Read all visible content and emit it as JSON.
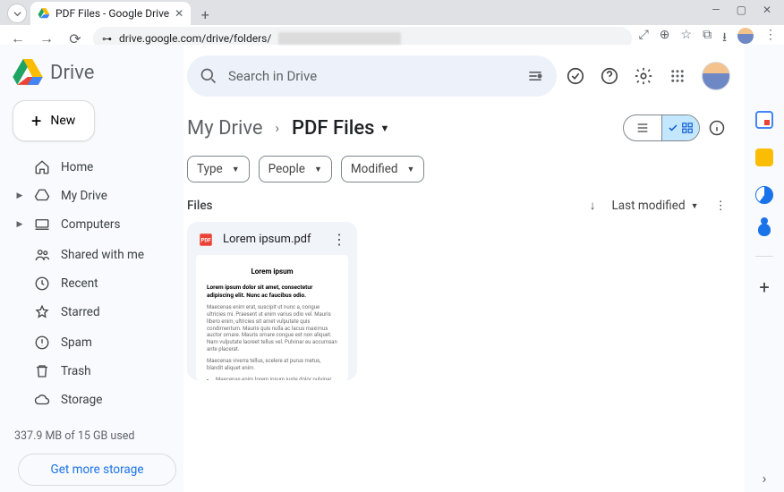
{
  "browser": {
    "tab_title": "PDF Files - Google Drive",
    "url_visible": "drive.google.com/drive/folders/",
    "url_obscured": "xxxxxxxxxxxxxxxxxxxxxxx"
  },
  "brand": "Drive",
  "new_button": "New",
  "nav": {
    "home": "Home",
    "my_drive": "My Drive",
    "computers": "Computers",
    "shared": "Shared with me",
    "recent": "Recent",
    "starred": "Starred",
    "spam": "Spam",
    "trash": "Trash",
    "storage": "Storage"
  },
  "storage": {
    "text": "337.9 MB of 15 GB used",
    "cta": "Get more storage"
  },
  "search": {
    "placeholder": "Search in Drive"
  },
  "breadcrumb": {
    "root": "My Drive",
    "current": "PDF Files"
  },
  "filters": {
    "type": "Type",
    "people": "People",
    "modified": "Modified"
  },
  "section_label": "Files",
  "sort_label": "Last modified",
  "file": {
    "name": "Lorem ipsum.pdf",
    "preview_title": "Lorem ipsum",
    "preview_lead": "Lorem ipsum dolor sit amet, consectetur adipiscing elit. Nunc ac faucibus odio."
  }
}
